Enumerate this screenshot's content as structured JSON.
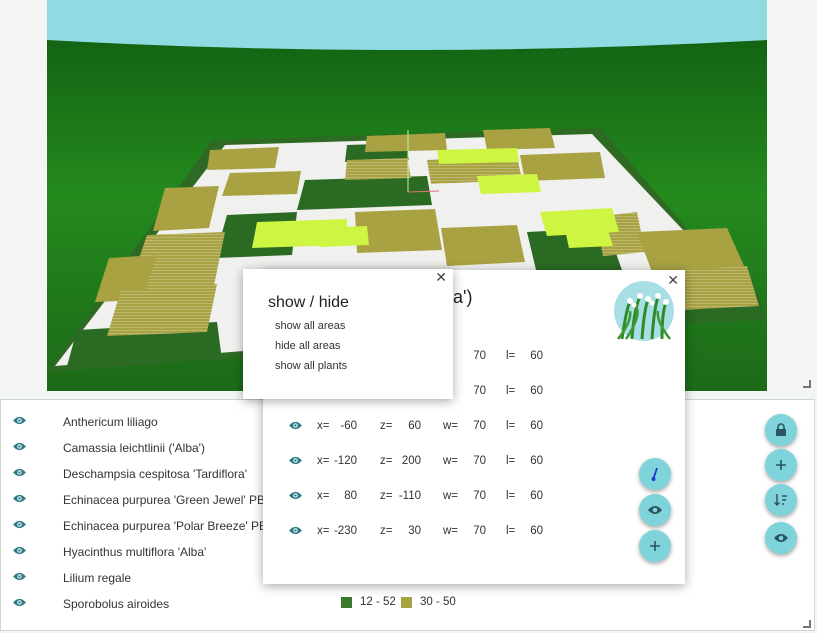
{
  "plants": [
    {
      "name": "Anthericum liliago"
    },
    {
      "name": "Camassia leichtlinii ('Alba')"
    },
    {
      "name": "Deschampsia cespitosa 'Tardiflora'"
    },
    {
      "name": "Echinacea purpurea 'Green Jewel' PBR"
    },
    {
      "name": "Echinacea purpurea 'Polar Breeze' PBR"
    },
    {
      "name": "Hyacinthus multiflora 'Alba'"
    },
    {
      "name": "Lilium regale"
    },
    {
      "name": "Sporobolus airoides"
    }
  ],
  "legend": [
    {
      "label": "12 - 52",
      "color": "#3d7a2e"
    },
    {
      "label": "30 - 50",
      "color": "#a8a243"
    }
  ],
  "detail": {
    "title_visible": "lba')",
    "areas": [
      {
        "x": "",
        "z": "",
        "w": "70",
        "l": "60",
        "partial": true
      },
      {
        "x": "",
        "z": "",
        "w": "70",
        "l": "60",
        "partial": true
      },
      {
        "x": "-60",
        "z": "60",
        "w": "70",
        "l": "60"
      },
      {
        "x": "-120",
        "z": "200",
        "w": "70",
        "l": "60"
      },
      {
        "x": "80",
        "z": "-110",
        "w": "70",
        "l": "60"
      },
      {
        "x": "-230",
        "z": "30",
        "w": "70",
        "l": "60"
      }
    ],
    "labels": {
      "x": "x=",
      "z": "z=",
      "w": "w=",
      "l": "l="
    },
    "close": "✕"
  },
  "popup": {
    "title": "show / hide",
    "items": [
      "show all areas",
      "hide all areas",
      "show all plants"
    ],
    "close": "✕"
  },
  "colors": {
    "accent": "#7fd4dc",
    "sky": "#8fdbe2",
    "grass": "#237a1c",
    "olive": "#a8a243",
    "lime": "#cdf542"
  },
  "icons": {
    "eye": "eye-icon",
    "lock": "lock-icon",
    "plus": "plus-icon",
    "sort": "sort-icon",
    "pen": "edit-icon"
  }
}
